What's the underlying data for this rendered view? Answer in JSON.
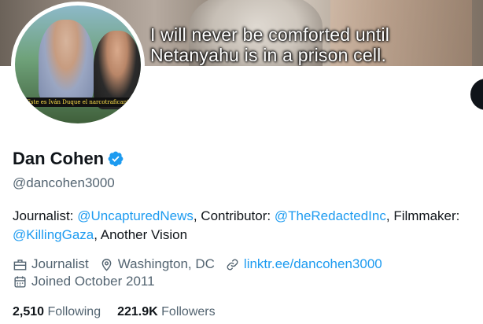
{
  "banner": {
    "caption_line1": "I will never be comforted until",
    "caption_line2": "Netanyahu is in a prison cell."
  },
  "avatar": {
    "subtitle": "¡Este es Iván Duque el narcotraficante!"
  },
  "profile": {
    "name": "Dan Cohen",
    "handle": "@dancohen3000",
    "verified_icon": "verified-badge-icon"
  },
  "bio": {
    "t1": "Journalist: ",
    "m1": "@UncapturedNews",
    "t2": ", Contributor: ",
    "m2": "@TheRedactedInc",
    "t3": ", Filmmaker: ",
    "m3": "@KillingGaza",
    "t4": ", Another Vision"
  },
  "meta": {
    "category": "Journalist",
    "location": "Washington, DC",
    "website": "linktr.ee/dancohen3000",
    "joined": "Joined October 2011"
  },
  "stats": {
    "following_count": "2,510",
    "following_label": "Following",
    "followers_count": "221.9K",
    "followers_label": "Followers"
  },
  "colors": {
    "link": "#1d9bf0",
    "secondary_text": "#536471",
    "primary_text": "#0f1419"
  }
}
